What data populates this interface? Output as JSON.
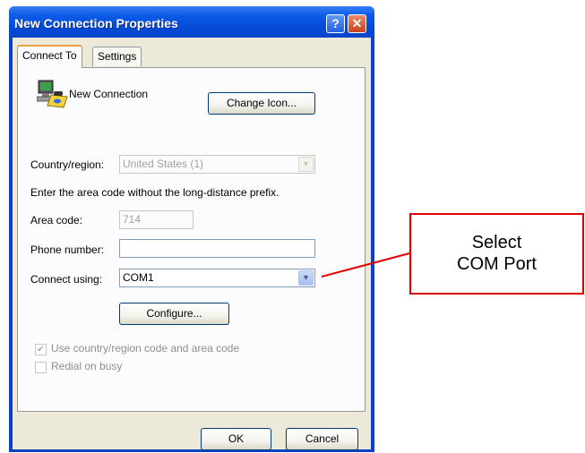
{
  "window": {
    "title": "New Connection Properties",
    "help_glyph": "?",
    "close_glyph": "✕"
  },
  "tabs": [
    {
      "label": "Connect To",
      "active": true
    },
    {
      "label": "Settings",
      "active": false
    }
  ],
  "connection": {
    "name": "New Connection",
    "icon": "phone-connection-icon",
    "change_icon_label": "Change Icon..."
  },
  "country": {
    "label": "Country/region:",
    "value": "United States (1)",
    "enabled": false
  },
  "instruction": "Enter the area code without the long-distance prefix.",
  "area_code": {
    "label": "Area code:",
    "value": "714",
    "enabled": false
  },
  "phone_number": {
    "label": "Phone number:",
    "value": ""
  },
  "connect_using": {
    "label": "Connect using:",
    "value": "COM1"
  },
  "configure_label": "Configure...",
  "options": [
    {
      "label": "Use country/region code and area code",
      "checked": true,
      "enabled": false
    },
    {
      "label": "Redial on busy",
      "checked": false,
      "enabled": false
    }
  ],
  "footer": {
    "ok_label": "OK",
    "cancel_label": "Cancel"
  },
  "annotation": {
    "line1": "Select",
    "line2": "COM Port",
    "color": "#e00000"
  },
  "colors": {
    "titlebar": "#0b5be8",
    "dialog_face": "#ece9d8",
    "close_button": "#c5421d"
  }
}
